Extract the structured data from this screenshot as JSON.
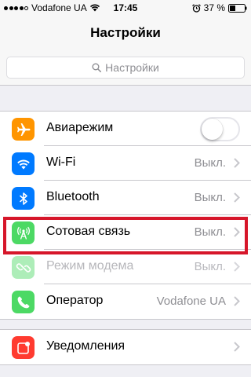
{
  "status_bar": {
    "carrier": "Vodafone UA",
    "time": "17:45",
    "battery_percent": "37 %",
    "signal_strength": 4,
    "icons": [
      "signal-dots-icon",
      "wifi-icon",
      "alarm-icon",
      "battery-icon"
    ]
  },
  "nav": {
    "title": "Настройки"
  },
  "search": {
    "placeholder": "Настройки"
  },
  "group1": {
    "airplane": {
      "label": "Авиарежим",
      "toggle_on": false,
      "icon": "airplane-icon",
      "color": "#ff9500"
    },
    "wifi": {
      "label": "Wi-Fi",
      "value": "Выкл.",
      "icon": "wifi-icon",
      "color": "#007aff"
    },
    "bluetooth": {
      "label": "Bluetooth",
      "value": "Выкл.",
      "icon": "bluetooth-icon",
      "color": "#007aff"
    },
    "cellular": {
      "label": "Сотовая связь",
      "value": "Выкл.",
      "icon": "cellular-antenna-icon",
      "color": "#4cd964"
    },
    "hotspot": {
      "label": "Режим модема",
      "value": "Выкл.",
      "icon": "hotspot-chain-icon",
      "color": "#4cd964"
    },
    "operator": {
      "label": "Оператор",
      "value": "Vodafone UA",
      "icon": "phone-icon",
      "color": "#4cd964"
    }
  },
  "group2": {
    "notifications": {
      "label": "Уведомления",
      "icon": "notifications-icon",
      "color": "#ff3b30"
    }
  },
  "highlight_color": "#d6162a"
}
